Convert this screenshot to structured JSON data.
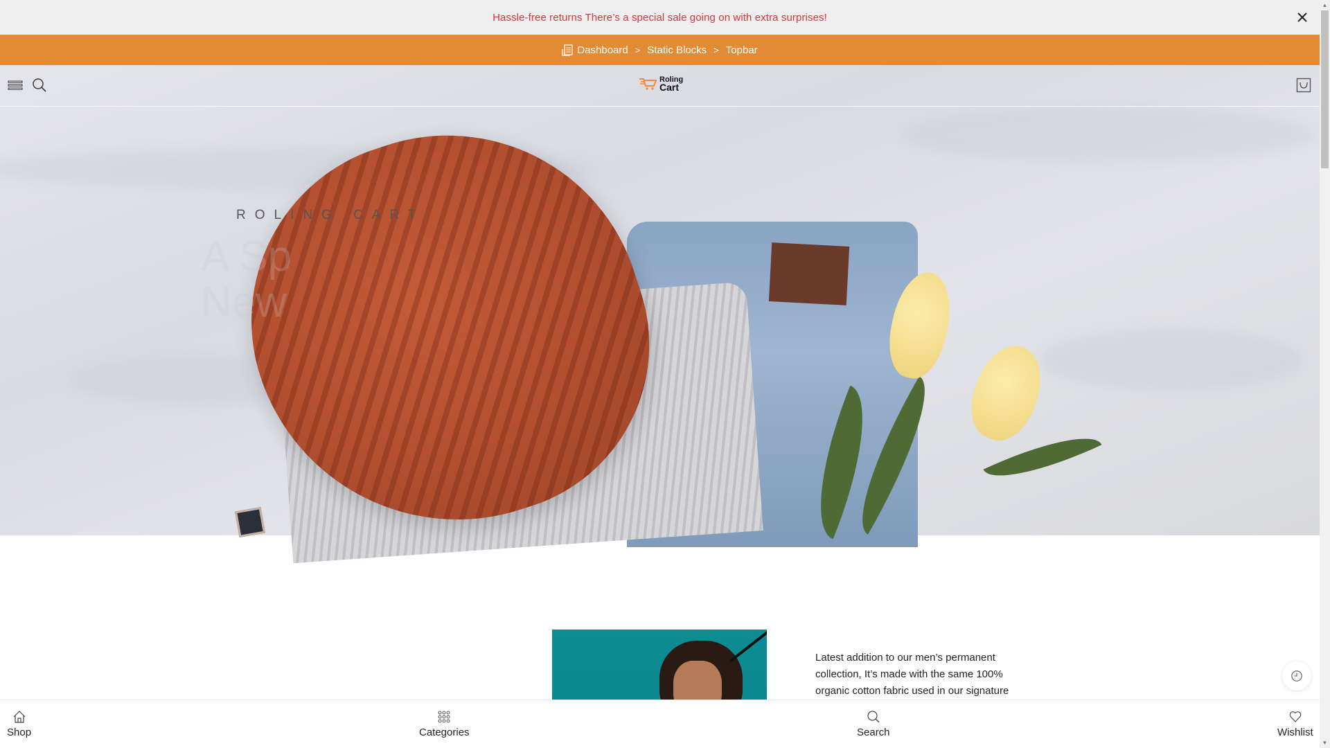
{
  "announcement": {
    "text": "Hassle-free returns There’s a special sale going on with extra surprises!",
    "text_color": "#d7343c",
    "close_icon": "close-icon"
  },
  "admin_bar": {
    "background": "#e38b34",
    "icon": "dashboard-icon",
    "breadcrumbs": [
      "Dashboard",
      "Static Blocks",
      "Topbar"
    ],
    "separator": ">"
  },
  "header": {
    "menu_icon": "hamburger-menu-icon",
    "search_icon": "search-icon",
    "logo": {
      "line1": "Roling",
      "line2": "Cart"
    },
    "cart_icon": "shopping-bag-icon"
  },
  "hero": {
    "eyebrow": "ROLING CART",
    "faded_line1": "A Sp",
    "faded_line2": "New"
  },
  "product": {
    "description": "Latest addition to our men’s permanent collection, It’s made with the same 100% organic cotton fabric used in our signature"
  },
  "history_button": {
    "icon": "clock-icon"
  },
  "bottom_nav": {
    "items": [
      {
        "label": "Shop",
        "icon": "home-icon"
      },
      {
        "label": "Categories",
        "icon": "grid-dots-icon"
      },
      {
        "label": "Search",
        "icon": "search-icon"
      },
      {
        "label": "Wishlist",
        "icon": "heart-icon"
      }
    ]
  }
}
